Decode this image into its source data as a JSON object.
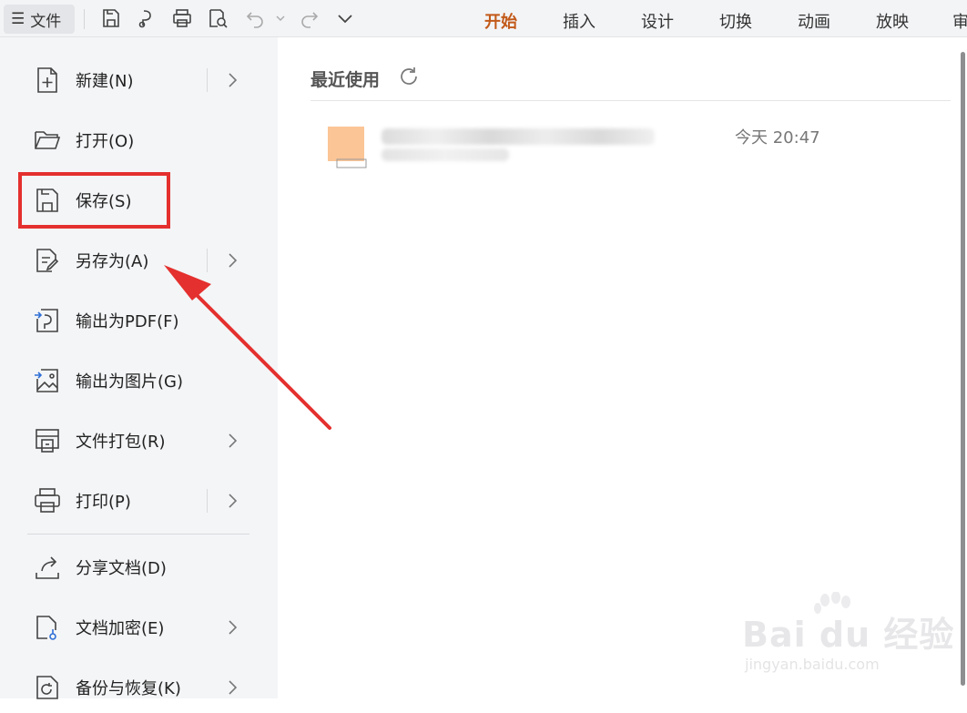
{
  "toolbar": {
    "file_label": "文件",
    "tabs": [
      {
        "label": "开始",
        "active": true
      },
      {
        "label": "插入",
        "active": false
      },
      {
        "label": "设计",
        "active": false
      },
      {
        "label": "切换",
        "active": false
      },
      {
        "label": "动画",
        "active": false
      },
      {
        "label": "放映",
        "active": false
      },
      {
        "label": "审",
        "active": false
      }
    ],
    "accent_color": "#c25a1a"
  },
  "menu": {
    "items": [
      {
        "label": "新建(N)",
        "icon": "new-file-icon",
        "submenu": true
      },
      {
        "label": "打开(O)",
        "icon": "folder-open-icon",
        "submenu": false
      },
      {
        "label": "保存(S)",
        "icon": "save-icon",
        "submenu": false,
        "highlighted": true
      },
      {
        "label": "另存为(A)",
        "icon": "save-as-icon",
        "submenu": true
      },
      {
        "label": "输出为PDF(F)",
        "icon": "export-pdf-icon",
        "submenu": false
      },
      {
        "label": "输出为图片(G)",
        "icon": "export-image-icon",
        "submenu": false
      },
      {
        "label": "文件打包(R)",
        "icon": "package-icon",
        "submenu": true
      },
      {
        "label": "打印(P)",
        "icon": "print-icon",
        "submenu": true
      },
      {
        "label": "分享文档(D)",
        "icon": "share-icon",
        "submenu": false
      },
      {
        "label": "文档加密(E)",
        "icon": "encrypt-icon",
        "submenu": true
      },
      {
        "label": "备份与恢复(K)",
        "icon": "backup-icon",
        "submenu": true
      }
    ],
    "highlight_color": "#e4302e"
  },
  "main": {
    "section_title": "最近使用",
    "recent_files": [
      {
        "time": "今天  20:47"
      }
    ]
  },
  "watermark": {
    "brand": "Bai du 经验",
    "url": "jingyan.baidu.com"
  }
}
